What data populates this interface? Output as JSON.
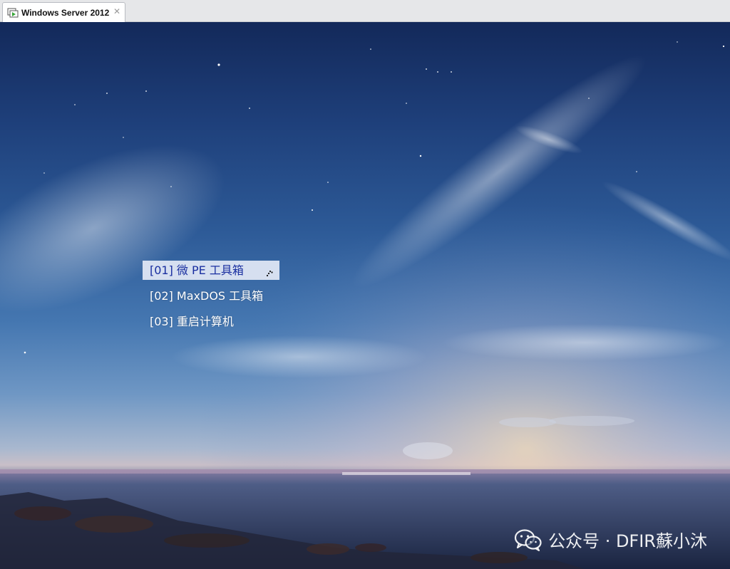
{
  "tab": {
    "title": "Windows Server 2012",
    "icon": "vm-play-icon",
    "close_icon": "close-icon"
  },
  "boot_menu": {
    "items": [
      {
        "label": "[01] 微 PE 工具箱",
        "selected": true
      },
      {
        "label": "[02] MaxDOS 工具箱",
        "selected": false
      },
      {
        "label": "[03] 重启计算机",
        "selected": false
      }
    ]
  },
  "watermark": {
    "text": "公众号 · DFIR蘇小沐",
    "icon": "wechat-icon"
  },
  "colors": {
    "selected_bg": "#d6dff0",
    "selected_text": "#1a2fa0",
    "menu_text": "#ffffff",
    "tab_bg": "#ffffff",
    "tabstrip_bg": "#e6e7e9"
  }
}
